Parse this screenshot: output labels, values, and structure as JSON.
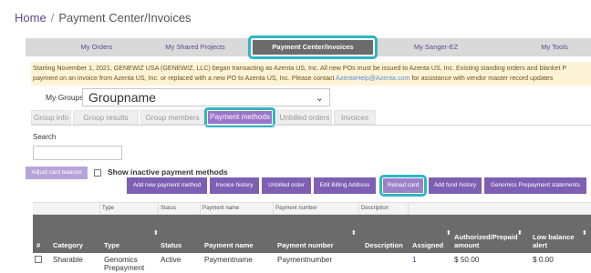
{
  "breadcrumb": {
    "home": "Home",
    "separator": "/",
    "current": "Payment Center/Invoices"
  },
  "topnav": {
    "items": [
      "My Orders",
      "My Shared Projects",
      "Payment Center/Invoices",
      "My Sanger-EZ",
      "My Tools"
    ],
    "active": "Payment Center/Invoices"
  },
  "notice": {
    "line1": "Starting November 1, 2021, GENEWIZ USA (GENEWIZ, LLC) began transacting as Azenta US, Inc. All new POs must be issued to Azenta US, Inc. Existing standing orders and blanket P",
    "line2_prefix": "payment on an invoice from Azenta US, Inc. or replaced with a new PO to Azenta US, Inc. Please contact ",
    "link": "AzentaHelp@Azenta.com",
    "line2_suffix": " for assistance with vendor master record updates"
  },
  "groups": {
    "label": "My Groups",
    "selected": "Groupname",
    "chevron": "⌄"
  },
  "tabs": [
    "Group info",
    "Group results",
    "Group members",
    "Payment methods",
    "Unbilled orders",
    "Invoices"
  ],
  "active_tab": "Payment methods",
  "search": {
    "label": "Search",
    "value": ""
  },
  "adjust_button": "Adjust card balance",
  "show_inactive": {
    "label": "Show inactive payment methods",
    "checked": false
  },
  "actions": [
    "Add new payment method",
    "Invoice history",
    "Unbilled order",
    "Edit Billing Address",
    "Reload card",
    "Add fund history",
    "Genomics Prepayment statements"
  ],
  "table": {
    "filter_row": [
      "Type",
      "Status",
      "Payment name",
      "Payment number",
      "Description"
    ],
    "headers": [
      "#",
      "Category",
      "Type",
      "Status",
      "Payment name",
      "Payment number",
      "Description",
      "Assigned",
      "Authorized/Prepaid amount",
      "Low balance alert"
    ],
    "rows": [
      {
        "category": "Sharable",
        "type": "Genomics Prepayment",
        "status": "Active",
        "payment_name": "Paymentname",
        "payment_number": "Paymentnumber",
        "description": "",
        "assigned": "1",
        "amount": "$ 50.00",
        "low_balance": "$ 0.00"
      }
    ]
  },
  "colors": {
    "accent": "#7e5fb3",
    "highlight": "#2fb6c3",
    "nav_active": "#6b6b6b",
    "notice_bg": "#fdf3d6"
  }
}
